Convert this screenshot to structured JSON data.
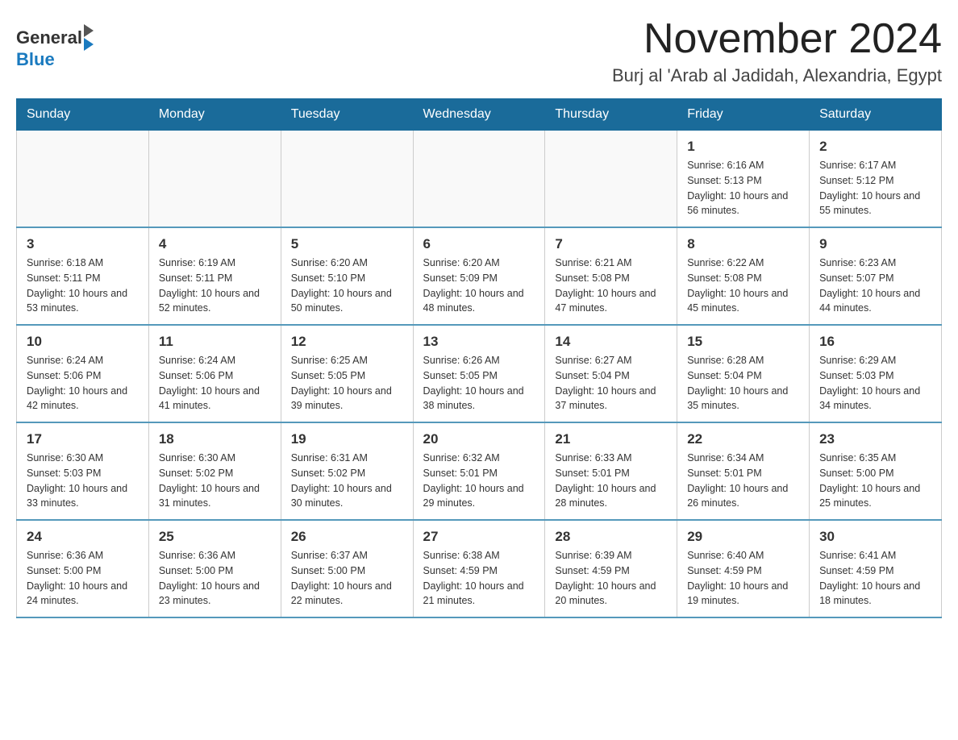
{
  "header": {
    "logo_general": "General",
    "logo_blue": "Blue",
    "month_title": "November 2024",
    "location": "Burj al 'Arab al Jadidah, Alexandria, Egypt"
  },
  "weekdays": [
    "Sunday",
    "Monday",
    "Tuesday",
    "Wednesday",
    "Thursday",
    "Friday",
    "Saturday"
  ],
  "weeks": [
    [
      {
        "day": "",
        "sunrise": "",
        "sunset": "",
        "daylight": ""
      },
      {
        "day": "",
        "sunrise": "",
        "sunset": "",
        "daylight": ""
      },
      {
        "day": "",
        "sunrise": "",
        "sunset": "",
        "daylight": ""
      },
      {
        "day": "",
        "sunrise": "",
        "sunset": "",
        "daylight": ""
      },
      {
        "day": "",
        "sunrise": "",
        "sunset": "",
        "daylight": ""
      },
      {
        "day": "1",
        "sunrise": "Sunrise: 6:16 AM",
        "sunset": "Sunset: 5:13 PM",
        "daylight": "Daylight: 10 hours and 56 minutes."
      },
      {
        "day": "2",
        "sunrise": "Sunrise: 6:17 AM",
        "sunset": "Sunset: 5:12 PM",
        "daylight": "Daylight: 10 hours and 55 minutes."
      }
    ],
    [
      {
        "day": "3",
        "sunrise": "Sunrise: 6:18 AM",
        "sunset": "Sunset: 5:11 PM",
        "daylight": "Daylight: 10 hours and 53 minutes."
      },
      {
        "day": "4",
        "sunrise": "Sunrise: 6:19 AM",
        "sunset": "Sunset: 5:11 PM",
        "daylight": "Daylight: 10 hours and 52 minutes."
      },
      {
        "day": "5",
        "sunrise": "Sunrise: 6:20 AM",
        "sunset": "Sunset: 5:10 PM",
        "daylight": "Daylight: 10 hours and 50 minutes."
      },
      {
        "day": "6",
        "sunrise": "Sunrise: 6:20 AM",
        "sunset": "Sunset: 5:09 PM",
        "daylight": "Daylight: 10 hours and 48 minutes."
      },
      {
        "day": "7",
        "sunrise": "Sunrise: 6:21 AM",
        "sunset": "Sunset: 5:08 PM",
        "daylight": "Daylight: 10 hours and 47 minutes."
      },
      {
        "day": "8",
        "sunrise": "Sunrise: 6:22 AM",
        "sunset": "Sunset: 5:08 PM",
        "daylight": "Daylight: 10 hours and 45 minutes."
      },
      {
        "day": "9",
        "sunrise": "Sunrise: 6:23 AM",
        "sunset": "Sunset: 5:07 PM",
        "daylight": "Daylight: 10 hours and 44 minutes."
      }
    ],
    [
      {
        "day": "10",
        "sunrise": "Sunrise: 6:24 AM",
        "sunset": "Sunset: 5:06 PM",
        "daylight": "Daylight: 10 hours and 42 minutes."
      },
      {
        "day": "11",
        "sunrise": "Sunrise: 6:24 AM",
        "sunset": "Sunset: 5:06 PM",
        "daylight": "Daylight: 10 hours and 41 minutes."
      },
      {
        "day": "12",
        "sunrise": "Sunrise: 6:25 AM",
        "sunset": "Sunset: 5:05 PM",
        "daylight": "Daylight: 10 hours and 39 minutes."
      },
      {
        "day": "13",
        "sunrise": "Sunrise: 6:26 AM",
        "sunset": "Sunset: 5:05 PM",
        "daylight": "Daylight: 10 hours and 38 minutes."
      },
      {
        "day": "14",
        "sunrise": "Sunrise: 6:27 AM",
        "sunset": "Sunset: 5:04 PM",
        "daylight": "Daylight: 10 hours and 37 minutes."
      },
      {
        "day": "15",
        "sunrise": "Sunrise: 6:28 AM",
        "sunset": "Sunset: 5:04 PM",
        "daylight": "Daylight: 10 hours and 35 minutes."
      },
      {
        "day": "16",
        "sunrise": "Sunrise: 6:29 AM",
        "sunset": "Sunset: 5:03 PM",
        "daylight": "Daylight: 10 hours and 34 minutes."
      }
    ],
    [
      {
        "day": "17",
        "sunrise": "Sunrise: 6:30 AM",
        "sunset": "Sunset: 5:03 PM",
        "daylight": "Daylight: 10 hours and 33 minutes."
      },
      {
        "day": "18",
        "sunrise": "Sunrise: 6:30 AM",
        "sunset": "Sunset: 5:02 PM",
        "daylight": "Daylight: 10 hours and 31 minutes."
      },
      {
        "day": "19",
        "sunrise": "Sunrise: 6:31 AM",
        "sunset": "Sunset: 5:02 PM",
        "daylight": "Daylight: 10 hours and 30 minutes."
      },
      {
        "day": "20",
        "sunrise": "Sunrise: 6:32 AM",
        "sunset": "Sunset: 5:01 PM",
        "daylight": "Daylight: 10 hours and 29 minutes."
      },
      {
        "day": "21",
        "sunrise": "Sunrise: 6:33 AM",
        "sunset": "Sunset: 5:01 PM",
        "daylight": "Daylight: 10 hours and 28 minutes."
      },
      {
        "day": "22",
        "sunrise": "Sunrise: 6:34 AM",
        "sunset": "Sunset: 5:01 PM",
        "daylight": "Daylight: 10 hours and 26 minutes."
      },
      {
        "day": "23",
        "sunrise": "Sunrise: 6:35 AM",
        "sunset": "Sunset: 5:00 PM",
        "daylight": "Daylight: 10 hours and 25 minutes."
      }
    ],
    [
      {
        "day": "24",
        "sunrise": "Sunrise: 6:36 AM",
        "sunset": "Sunset: 5:00 PM",
        "daylight": "Daylight: 10 hours and 24 minutes."
      },
      {
        "day": "25",
        "sunrise": "Sunrise: 6:36 AM",
        "sunset": "Sunset: 5:00 PM",
        "daylight": "Daylight: 10 hours and 23 minutes."
      },
      {
        "day": "26",
        "sunrise": "Sunrise: 6:37 AM",
        "sunset": "Sunset: 5:00 PM",
        "daylight": "Daylight: 10 hours and 22 minutes."
      },
      {
        "day": "27",
        "sunrise": "Sunrise: 6:38 AM",
        "sunset": "Sunset: 4:59 PM",
        "daylight": "Daylight: 10 hours and 21 minutes."
      },
      {
        "day": "28",
        "sunrise": "Sunrise: 6:39 AM",
        "sunset": "Sunset: 4:59 PM",
        "daylight": "Daylight: 10 hours and 20 minutes."
      },
      {
        "day": "29",
        "sunrise": "Sunrise: 6:40 AM",
        "sunset": "Sunset: 4:59 PM",
        "daylight": "Daylight: 10 hours and 19 minutes."
      },
      {
        "day": "30",
        "sunrise": "Sunrise: 6:41 AM",
        "sunset": "Sunset: 4:59 PM",
        "daylight": "Daylight: 10 hours and 18 minutes."
      }
    ]
  ]
}
